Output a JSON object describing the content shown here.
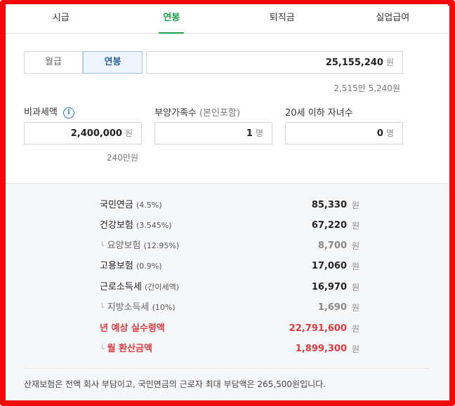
{
  "tabs": [
    "시급",
    "연봉",
    "퇴직금",
    "실업급여"
  ],
  "pay_toggle": {
    "monthly": "월급",
    "annual": "연봉"
  },
  "salary": {
    "value": "25,155,240",
    "unit": "원",
    "readable": "2,515만 5,240원"
  },
  "non_taxable": {
    "label": "비과세액",
    "info_icon": "i",
    "value": "2,400,000",
    "unit": "원",
    "readable": "240만원"
  },
  "dependents": {
    "label": "부양가족수",
    "label_note": "(본인포함)",
    "value": "1",
    "unit": "명"
  },
  "children": {
    "label": "20세 이하 자녀수",
    "value": "0",
    "unit": "명"
  },
  "results": [
    {
      "name": "국민연금",
      "pct": "(4.5%)",
      "value": "85,330",
      "unit": "원",
      "sub": false,
      "red": false
    },
    {
      "name": "건강보험",
      "pct": "(3.545%)",
      "value": "67,220",
      "unit": "원",
      "sub": false,
      "red": false
    },
    {
      "name": "요양보험",
      "pct": "(12.95%)",
      "value": "8,700",
      "unit": "원",
      "sub": true,
      "red": false
    },
    {
      "name": "고용보험",
      "pct": "(0.9%)",
      "value": "17,060",
      "unit": "원",
      "sub": false,
      "red": false
    },
    {
      "name": "근로소득세",
      "pct": "(간이세액)",
      "value": "16,970",
      "unit": "원",
      "sub": false,
      "red": false
    },
    {
      "name": "지방소득세",
      "pct": "(10%)",
      "value": "1,690",
      "unit": "원",
      "sub": true,
      "red": false
    },
    {
      "name": "년 예상 실수령액",
      "pct": "",
      "value": "22,791,600",
      "unit": "원",
      "sub": false,
      "red": true
    },
    {
      "name": "월 환산금액",
      "pct": "",
      "value": "1,899,300",
      "unit": "원",
      "sub": true,
      "red": true
    }
  ],
  "footnote": "산재보험은 전액 회사 부담이고, 국민연금의 근로자 최대 부담액은 265,500원입니다.",
  "colors": {
    "frame": "#f20a0a",
    "accent_green": "#1aa14a",
    "highlight_red": "#e0393f",
    "toggle_blue": "#2b5f9e"
  }
}
